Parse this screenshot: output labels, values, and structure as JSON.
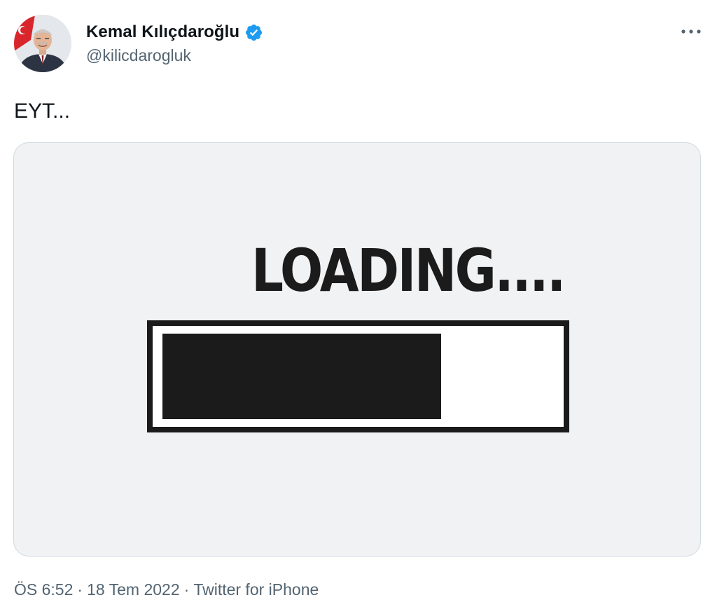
{
  "author": {
    "display_name": "Kemal Kılıçdaroğlu",
    "handle": "@kilicdarogluk",
    "verified": true,
    "verified_icon": "verified-badge-icon",
    "verified_color": "#1d9bf0"
  },
  "tweet": {
    "text": "EYT..."
  },
  "media": {
    "loading_text": "LOADING....",
    "progress": 0.71
  },
  "meta": {
    "time": "ÖS 6:52",
    "separator": "·",
    "date": "18 Tem 2022",
    "source": "Twitter for iPhone"
  },
  "more_icon": "more-options-icon",
  "colors": {
    "text_primary": "#0f1419",
    "text_secondary": "#536471",
    "media_background": "#f1f2f4",
    "progress_dark": "#1b1b1b"
  }
}
